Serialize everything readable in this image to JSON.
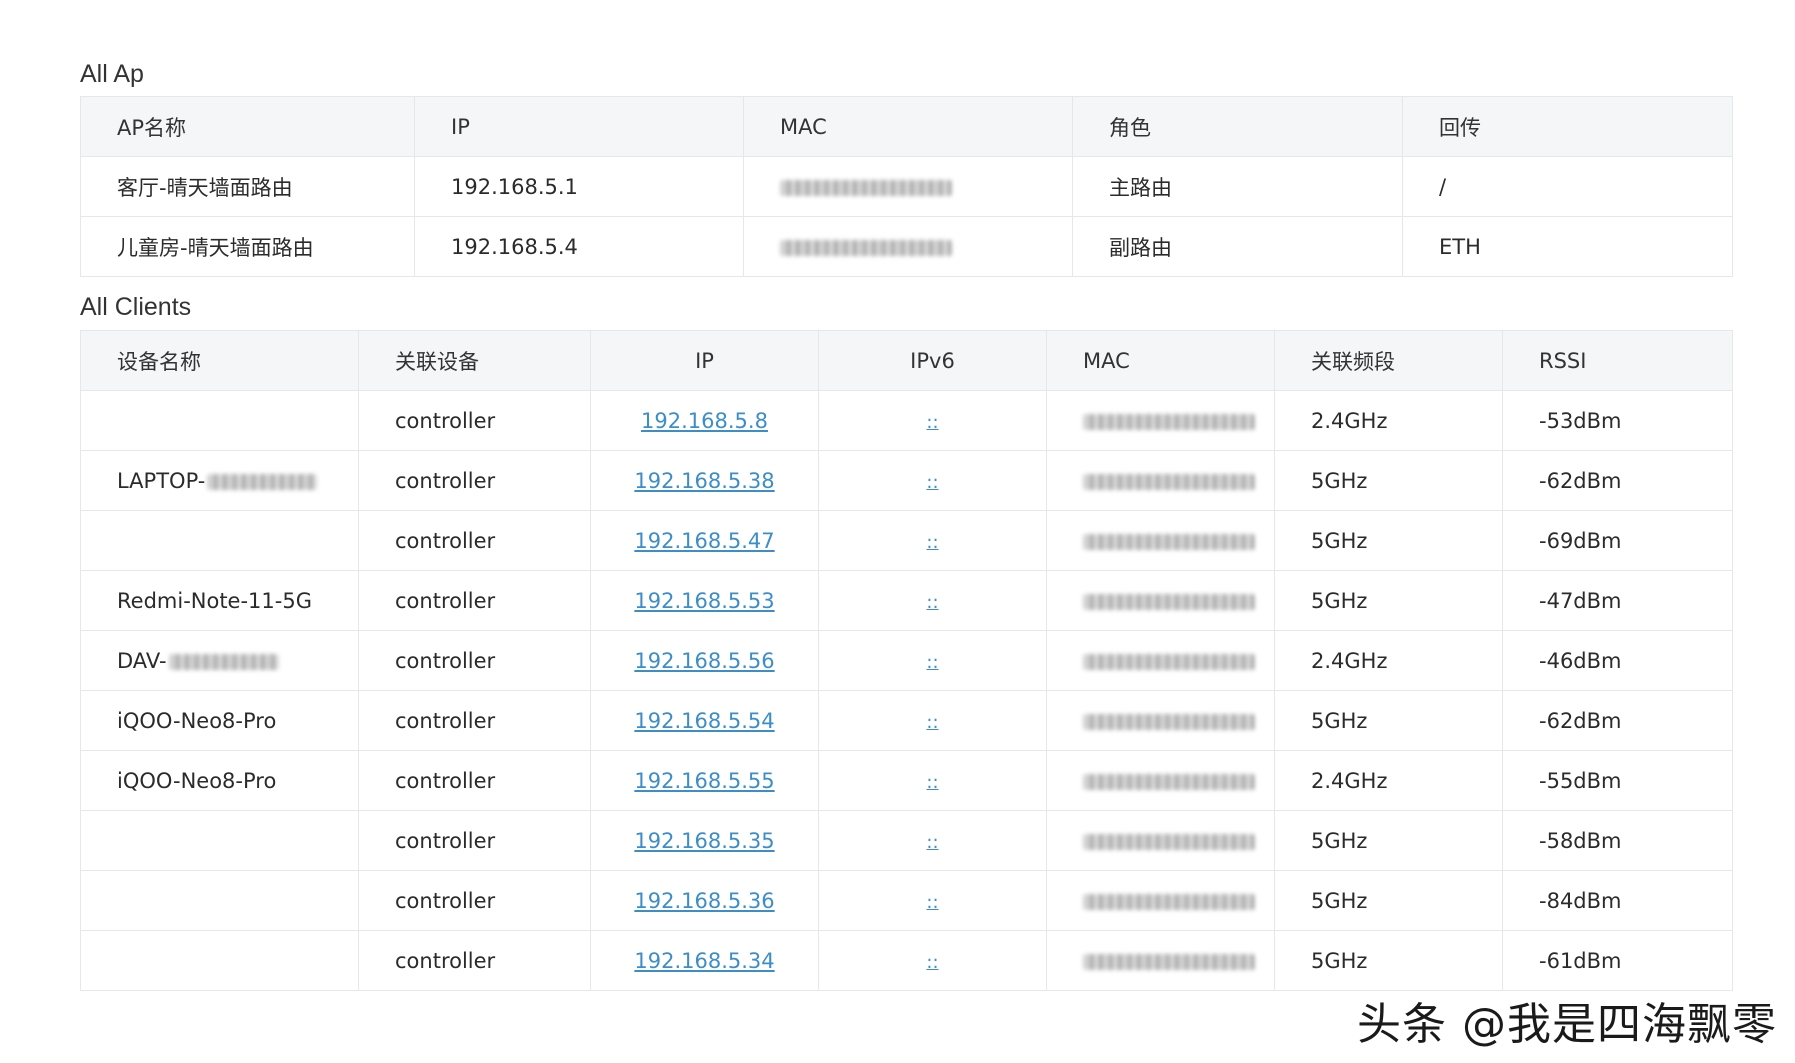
{
  "ap_section": {
    "title": "All Ap",
    "headers": [
      "AP名称",
      "IP",
      "MAC",
      "角色",
      "回传"
    ],
    "rows": [
      {
        "name": "客厅-晴天墙面路由",
        "ip": "192.168.5.1",
        "role": "主路由",
        "backhaul": "/"
      },
      {
        "name": "儿童房-晴天墙面路由",
        "ip": "192.168.5.4",
        "role": "副路由",
        "backhaul": "ETH"
      }
    ]
  },
  "clients_section": {
    "title": "All Clients",
    "headers": [
      "设备名称",
      "关联设备",
      "IP",
      "IPv6",
      "MAC",
      "关联频段",
      "RSSI"
    ],
    "rows": [
      {
        "name": "",
        "assoc": "controller",
        "ip": "192.168.5.8",
        "ipv6": "::",
        "band": "2.4GHz",
        "rssi": "-53dBm"
      },
      {
        "name": "LAPTOP-",
        "assoc": "controller",
        "ip": "192.168.5.38",
        "ipv6": "::",
        "band": "5GHz",
        "rssi": "-62dBm"
      },
      {
        "name": "",
        "assoc": "controller",
        "ip": "192.168.5.47",
        "ipv6": "::",
        "band": "5GHz",
        "rssi": "-69dBm"
      },
      {
        "name": "Redmi-Note-11-5G",
        "assoc": "controller",
        "ip": "192.168.5.53",
        "ipv6": "::",
        "band": "5GHz",
        "rssi": "-47dBm"
      },
      {
        "name": "DAV-",
        "assoc": "controller",
        "ip": "192.168.5.56",
        "ipv6": "::",
        "band": "2.4GHz",
        "rssi": "-46dBm"
      },
      {
        "name": "iQOO-Neo8-Pro",
        "assoc": "controller",
        "ip": "192.168.5.54",
        "ipv6": "::",
        "band": "5GHz",
        "rssi": "-62dBm"
      },
      {
        "name": "iQOO-Neo8-Pro",
        "assoc": "controller",
        "ip": "192.168.5.55",
        "ipv6": "::",
        "band": "2.4GHz",
        "rssi": "-55dBm"
      },
      {
        "name": "",
        "assoc": "controller",
        "ip": "192.168.5.35",
        "ipv6": "::",
        "band": "5GHz",
        "rssi": "-58dBm"
      },
      {
        "name": "",
        "assoc": "controller",
        "ip": "192.168.5.36",
        "ipv6": "::",
        "band": "5GHz",
        "rssi": "-84dBm"
      },
      {
        "name": "",
        "assoc": "controller",
        "ip": "192.168.5.34",
        "ipv6": "::",
        "band": "5GHz",
        "rssi": "-61dBm"
      }
    ]
  },
  "watermark": "头条 @我是四海飘零"
}
